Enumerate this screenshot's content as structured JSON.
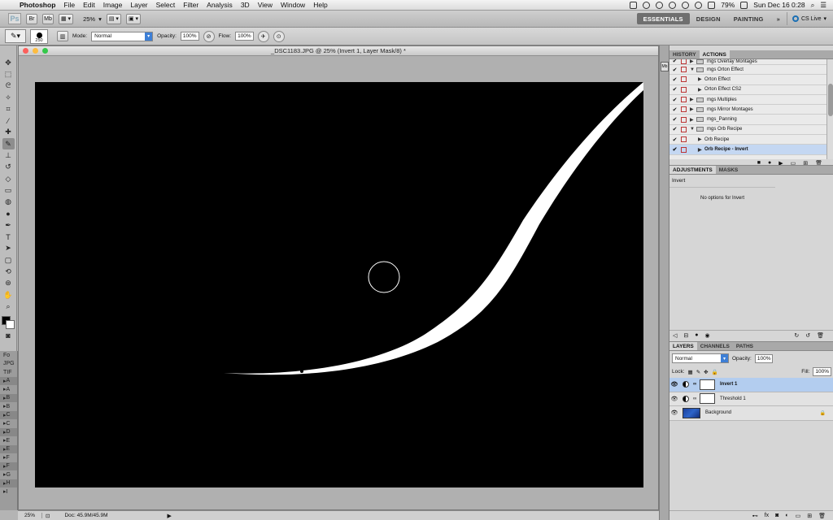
{
  "menubar": {
    "app": "Photoshop",
    "items": [
      "File",
      "Edit",
      "Image",
      "Layer",
      "Select",
      "Filter",
      "Analysis",
      "3D",
      "View",
      "Window",
      "Help"
    ],
    "battery": "79%",
    "clock": "Sun Dec 16  0:28"
  },
  "appbar": {
    "logo": "Ps",
    "zoom": "25%",
    "workspaces": [
      "ESSENTIALS",
      "DESIGN",
      "PAINTING"
    ],
    "more": "»",
    "cs_live": "CS Live"
  },
  "options": {
    "brush_size": "250",
    "mode_label": "Mode:",
    "mode_value": "Normal",
    "opacity_label": "Opacity:",
    "opacity_value": "100%",
    "flow_label": "Flow:",
    "flow_value": "100%"
  },
  "toolbox": {
    "tools": [
      "move-icon",
      "marquee-icon",
      "lasso-icon",
      "quick-select-icon",
      "crop-icon",
      "eyedropper-icon",
      "healing-icon",
      "brush-icon",
      "stamp-icon",
      "history-brush-icon",
      "eraser-icon",
      "gradient-icon",
      "blur-icon",
      "dodge-icon",
      "pen-icon",
      "type-icon",
      "path-select-icon",
      "shape-icon",
      "3d-rotate-icon",
      "3d-orbit-icon",
      "hand-icon",
      "zoom-icon"
    ],
    "active_index": 7
  },
  "strip": {
    "rows": [
      "Fo",
      "JPG",
      "TIF",
      "A",
      "A",
      "B",
      "B",
      "C",
      "C",
      "D",
      "E",
      "E",
      "F",
      "F",
      "G",
      "H",
      "I"
    ]
  },
  "document": {
    "title": "_DSC1183.JPG @ 25% (Invert 1, Layer Mask/8) *"
  },
  "status": {
    "zoom": "25%",
    "doc": "Doc: 45.9M/45.9M"
  },
  "actions_panel": {
    "tabs": [
      "HISTORY",
      "ACTIONS"
    ],
    "active_tab": 1,
    "rows": [
      {
        "name": "mgs Overlay Montages",
        "type": "set",
        "expanded": false
      },
      {
        "name": "mgs Orton Effect",
        "type": "set",
        "expanded": true
      },
      {
        "name": "Orton Effect",
        "type": "action"
      },
      {
        "name": "Orton Effect CS2",
        "type": "action"
      },
      {
        "name": "mgs Multiples",
        "type": "set",
        "expanded": false
      },
      {
        "name": "mgs Mirror Montages",
        "type": "set",
        "expanded": false
      },
      {
        "name": "mgs_Panning",
        "type": "set",
        "expanded": false
      },
      {
        "name": "mgs Orb Recipe",
        "type": "set",
        "expanded": true
      },
      {
        "name": "Orb Recipe",
        "type": "action"
      },
      {
        "name": "Orb Recipe - Invert",
        "type": "action",
        "selected": true
      }
    ]
  },
  "adjustments_panel": {
    "tabs": [
      "ADJUSTMENTS",
      "MASKS"
    ],
    "active_tab": 0,
    "heading": "Invert",
    "message": "No options for Invert"
  },
  "layers_panel": {
    "tabs": [
      "LAYERS",
      "CHANNELS",
      "PATHS"
    ],
    "active_tab": 0,
    "blend_mode": "Normal",
    "opacity_label": "Opacity:",
    "opacity_value": "100%",
    "lock_label": "Lock:",
    "fill_label": "Fill:",
    "fill_value": "100%",
    "layers": [
      {
        "name": "Invert 1",
        "kind": "adjustment",
        "selected": true
      },
      {
        "name": "Threshold 1",
        "kind": "adjustment",
        "selected": false
      },
      {
        "name": "Background",
        "kind": "image",
        "locked": true
      }
    ]
  }
}
